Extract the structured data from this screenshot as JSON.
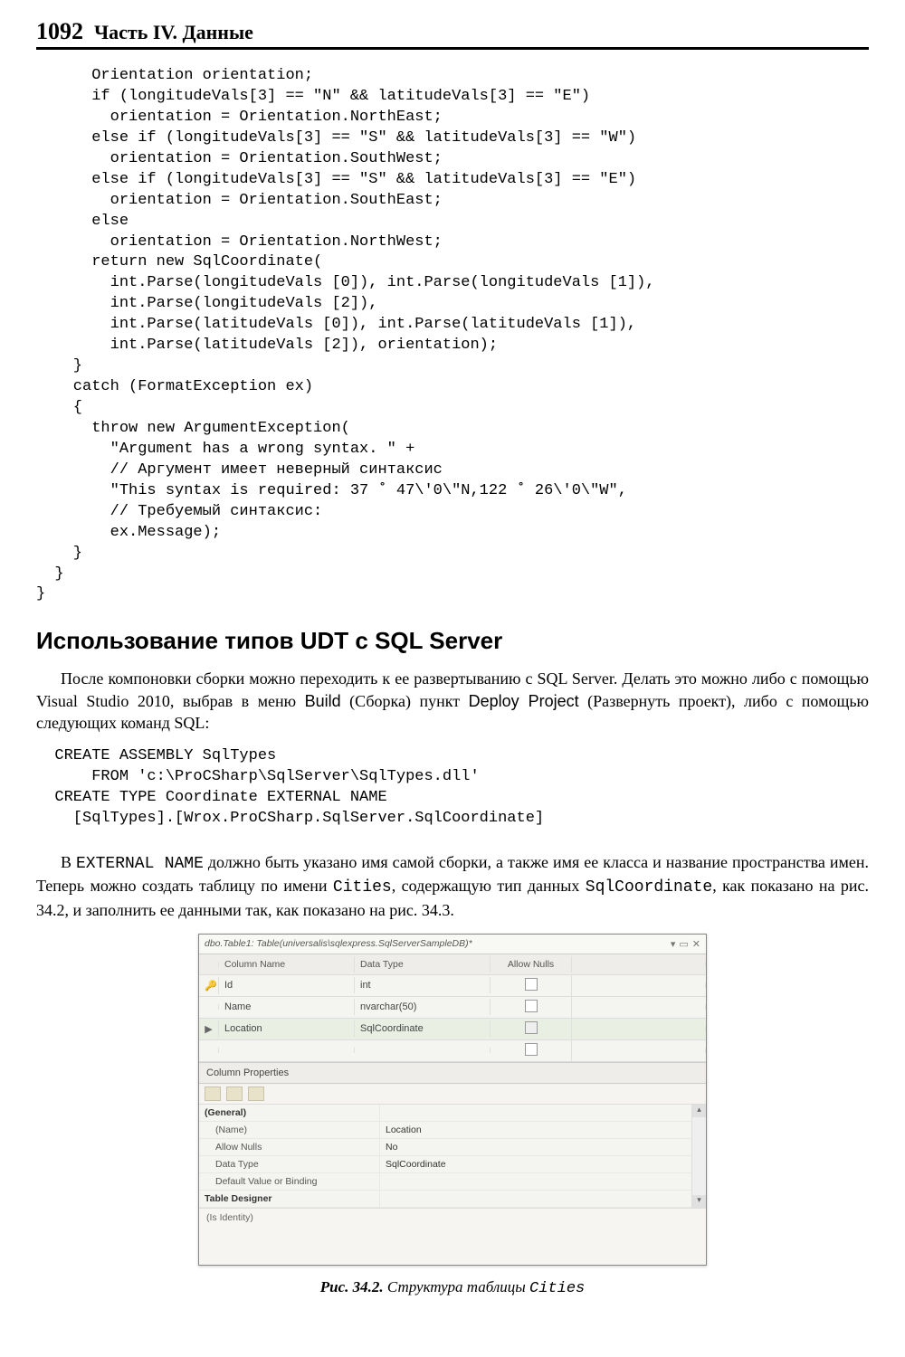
{
  "header": {
    "page_number": "1092",
    "part_title": "Часть IV. Данные"
  },
  "code_block_1": "      Orientation orientation;\n      if (longitudeVals[3] == \"N\" && latitudeVals[3] == \"E\")\n        orientation = Orientation.NorthEast;\n      else if (longitudeVals[3] == \"S\" && latitudeVals[3] == \"W\")\n        orientation = Orientation.SouthWest;\n      else if (longitudeVals[3] == \"S\" && latitudeVals[3] == \"E\")\n        orientation = Orientation.SouthEast;\n      else\n        orientation = Orientation.NorthWest;\n      return new SqlCoordinate(\n        int.Parse(longitudeVals [0]), int.Parse(longitudeVals [1]),\n        int.Parse(longitudeVals [2]),\n        int.Parse(latitudeVals [0]), int.Parse(latitudeVals [1]),\n        int.Parse(latitudeVals [2]), orientation);\n    }\n    catch (FormatException ex)\n    {\n      throw new ArgumentException(\n        \"Argument has a wrong syntax. \" +\n        // Аргумент имеет неверный синтаксис\n        \"This syntax is required: 37 ˚ 47\\'0\\\"N,122 ˚ 26\\'0\\\"W\",\n        // Требуемый синтаксис:\n        ex.Message);\n    }\n  }\n}",
  "section_heading": "Использование типов UDT с SQL Server",
  "para1_parts": {
    "a": "После компоновки сборки можно переходить к ее развертыванию с SQL Server. Делать это можно либо с помощью Visual Studio 2010, выбрав в меню ",
    "b": "Build",
    "c": " (Сборка) пункт ",
    "d": "Deploy Project",
    "e": " (Развернуть проект), либо с помощью следующих команд SQL:"
  },
  "code_block_2": "  CREATE ASSEMBLY SqlTypes\n      FROM 'c:\\ProCSharp\\SqlServer\\SqlTypes.dll'\n  CREATE TYPE Coordinate EXTERNAL NAME\n    [SqlTypes].[Wrox.ProCSharp.SqlServer.SqlCoordinate]",
  "para2_parts": {
    "a": "В ",
    "b": "EXTERNAL NAME",
    "c": " должно быть указано имя самой сборки, а также имя ее класса и название пространства имен. Теперь можно создать таблицу по имени ",
    "d": "Cities",
    "e": ", содержащую тип данных ",
    "f": "SqlCoordinate",
    "g": ", как показано на рис. 34.2, и заполнить ее данными так, как показано на рис. 34.3."
  },
  "figure": {
    "title": "dbo.Table1: Table(universalis\\sqlexpress.SqlServerSampleDB)*",
    "columns": {
      "name": "Column Name",
      "type": "Data Type",
      "nulls": "Allow Nulls"
    },
    "rows": [
      {
        "mark": "🔑",
        "name": "Id",
        "type": "int",
        "null_checked": false
      },
      {
        "mark": "",
        "name": "Name",
        "type": "nvarchar(50)",
        "null_checked": false
      },
      {
        "mark": "▶",
        "name": "Location",
        "type": "SqlCoordinate",
        "null_checked": false,
        "selected": true
      },
      {
        "mark": "",
        "name": "",
        "type": "",
        "null_checked": false
      }
    ],
    "props_title": "Column Properties",
    "props": {
      "cat1": "(General)",
      "name_lbl": "(Name)",
      "name_val": "Location",
      "nulls_lbl": "Allow Nulls",
      "nulls_val": "No",
      "dtype_lbl": "Data Type",
      "dtype_val": "SqlCoordinate",
      "def_lbl": "Default Value or Binding",
      "def_val": "",
      "cat2": "Table Designer"
    },
    "desc": "(Is Identity)"
  },
  "caption": {
    "a": "Рис. 34.2. ",
    "b": "Структура таблицы ",
    "c": "Cities"
  }
}
